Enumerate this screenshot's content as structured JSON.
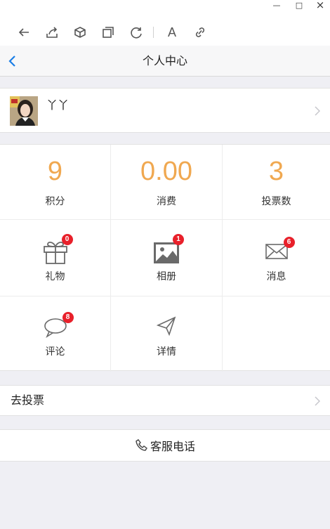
{
  "window": {
    "minimize": "—",
    "maximize": "□",
    "close": "×"
  },
  "toolbar": {
    "items": [
      {
        "icon": "back-arrow-icon"
      },
      {
        "icon": "share-icon"
      },
      {
        "icon": "box-icon"
      },
      {
        "icon": "copy-icon"
      },
      {
        "icon": "refresh-icon"
      },
      {
        "icon": "font-icon",
        "label": "A"
      },
      {
        "icon": "link-icon"
      }
    ]
  },
  "navbar": {
    "title": "个人中心",
    "back_icon": "chevron-left-icon"
  },
  "profile": {
    "name": "丫丫"
  },
  "stats": [
    {
      "value": "9",
      "label": "积分"
    },
    {
      "value": "0.00",
      "label": "消费"
    },
    {
      "value": "3",
      "label": "投票数"
    }
  ],
  "features": [
    {
      "label": "礼物",
      "badge": "0",
      "icon": "gift-icon"
    },
    {
      "label": "相册",
      "badge": "1",
      "icon": "photo-album-icon"
    },
    {
      "label": "消息",
      "badge": "6",
      "icon": "envelope-icon"
    },
    {
      "label": "评论",
      "badge": "8",
      "icon": "comment-bubble-icon"
    },
    {
      "label": "详情",
      "icon": "paper-plane-icon"
    }
  ],
  "vote_row": {
    "label": "去投票"
  },
  "service": {
    "label": "客服电话",
    "icon": "phone-icon"
  },
  "colors": {
    "accent": "#f0a850",
    "badge": "#e8202a",
    "link": "#1a7ee6"
  }
}
